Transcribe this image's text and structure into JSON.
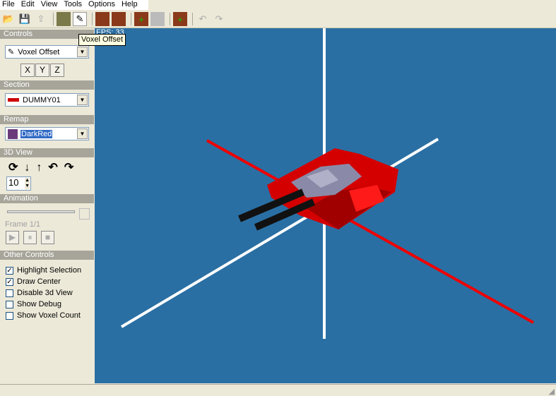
{
  "menu": [
    "File",
    "Edit",
    "View",
    "Tools",
    "Options",
    "Help"
  ],
  "toolbar": {
    "icons": [
      "open-icon",
      "save-icon",
      "export-icon",
      "tank-icon",
      "voxel-offset-icon",
      "section-icon",
      "section-alt-icon",
      "add-section-icon",
      "blank-icon",
      "add-remap-icon",
      "undo-icon",
      "redo-icon"
    ]
  },
  "tooltip": "Voxel Offset",
  "controls": {
    "header": "Controls",
    "mode": "Voxel Offset",
    "axes": [
      "X",
      "Y",
      "Z"
    ]
  },
  "section": {
    "header": "Section",
    "value": "DUMMY01"
  },
  "remap": {
    "header": "Remap",
    "value": "DarkRed",
    "swatch": "#6a3c7a"
  },
  "view3d": {
    "header": "3D View",
    "step": "10"
  },
  "animation": {
    "header": "Animation",
    "frame": "Frame 1/1"
  },
  "other": {
    "header": "Other Controls",
    "options": [
      {
        "label": "Highlight Selection",
        "checked": true
      },
      {
        "label": "Draw Center",
        "checked": true
      },
      {
        "label": "Disable 3d View",
        "checked": false
      },
      {
        "label": "Show Debug",
        "checked": false
      },
      {
        "label": "Show Voxel Count",
        "checked": false
      }
    ]
  },
  "viewport": {
    "fps": "FPS: 33",
    "background": "#2a6fa3"
  }
}
